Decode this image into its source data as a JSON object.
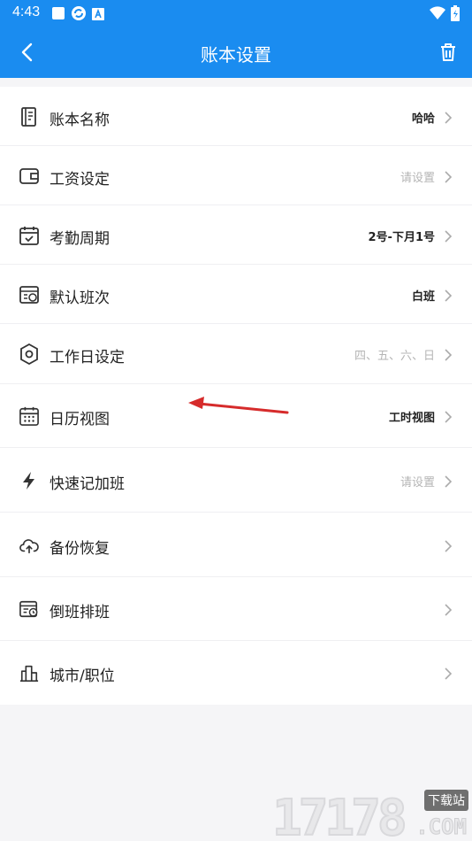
{
  "status_bar": {
    "time": "4:43",
    "left_icons": [
      "stop-icon",
      "sync-icon",
      "a-badge-icon"
    ],
    "right_icons": [
      "wifi-icon",
      "battery-charging-icon"
    ]
  },
  "header": {
    "title": "账本设置",
    "back_icon": "chevron-left-icon",
    "delete_icon": "trash-icon"
  },
  "colors": {
    "primary": "#1a8cf0",
    "placeholder": "#b5b5b5",
    "annotation_arrow": "#d62b2b"
  },
  "settings": [
    {
      "icon": "ledger-icon",
      "label": "账本名称",
      "value": "哈哈",
      "placeholder": false
    },
    {
      "icon": "wallet-icon",
      "label": "工资设定",
      "value": "请设置",
      "placeholder": true
    },
    {
      "icon": "calendar-check-icon",
      "label": "考勤周期",
      "value": "2号-下月1号",
      "placeholder": false
    },
    {
      "icon": "shift-schedule-icon",
      "label": "默认班次",
      "value": "白班",
      "placeholder": false
    },
    {
      "icon": "hexagon-settings-icon",
      "label": "工作日设定",
      "value": "四、五、六、日",
      "placeholder": true
    },
    {
      "icon": "calendar-grid-icon",
      "label": "日历视图",
      "value": "工时视图",
      "placeholder": false
    },
    {
      "icon": "lightning-icon",
      "label": "快速记加班",
      "value": "请设置",
      "placeholder": true
    },
    {
      "icon": "cloud-upload-icon",
      "label": "备份恢复",
      "value": "",
      "placeholder": false
    },
    {
      "icon": "calendar-rotate-icon",
      "label": "倒班排班",
      "value": "",
      "placeholder": false
    },
    {
      "icon": "city-icon",
      "label": "城市/职位",
      "value": "",
      "placeholder": false
    }
  ],
  "watermark": {
    "digits": "17178",
    "tag": "下载站",
    "domain": ".COM"
  }
}
